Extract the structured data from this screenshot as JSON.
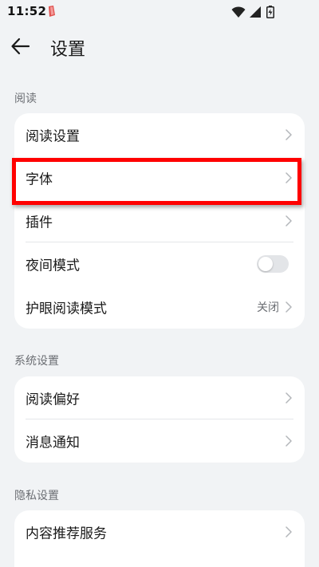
{
  "status_bar": {
    "time": "11:52",
    "icons": [
      "notification-icon",
      "wifi-icon",
      "signal-icon",
      "battery-icon"
    ]
  },
  "header": {
    "title": "设置",
    "back_icon": "arrow-left-icon"
  },
  "sections": {
    "reading": {
      "label": "阅读",
      "items": {
        "reading_settings": "阅读设置",
        "font": "字体",
        "plugins": "插件",
        "night_mode": "夜间模式",
        "eye_care": "护眼阅读模式",
        "eye_care_value": "关闭"
      },
      "night_mode_enabled": false
    },
    "system": {
      "label": "系统设置",
      "items": {
        "reading_preferences": "阅读偏好",
        "notifications": "消息通知"
      }
    },
    "privacy": {
      "label": "隐私设置",
      "items": {
        "content_recommendation": "内容推荐服务"
      }
    }
  },
  "colors": {
    "background": "#f1f3f5",
    "card": "#ffffff",
    "highlight": "#ff0000",
    "secondary_text": "#6b6e73"
  }
}
